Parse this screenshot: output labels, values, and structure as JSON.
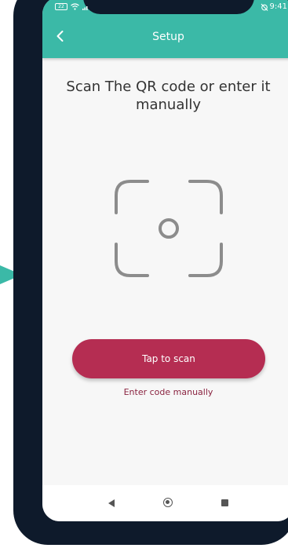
{
  "status_bar": {
    "battery_label": "22",
    "time": "9:41"
  },
  "app_bar": {
    "title": "Setup",
    "back_icon": "chevron-left-icon"
  },
  "content": {
    "heading": "Scan The QR code or enter it manually",
    "scan_frame_icon": "scan-frame-icon",
    "primary_button": "Tap to scan",
    "secondary_link": "Enter code manually"
  },
  "nav_bar": {
    "back_icon": "triangle-back-icon",
    "home_icon": "home-circle-icon",
    "recents_icon": "recents-square-icon"
  },
  "colors": {
    "app_bar": "#3bb9a7",
    "primary_button": "#b52d52",
    "link": "#8a2340",
    "device_frame": "#0e1a2b"
  }
}
